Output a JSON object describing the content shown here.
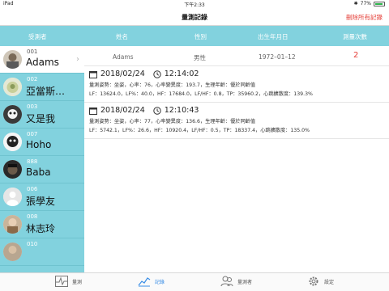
{
  "status_bar": {
    "device": "iPad",
    "time": "下午2:33",
    "battery": "77%",
    "battery_level": 0.77
  },
  "nav": {
    "title": "量測記錄",
    "delete_all": "刪除所有記錄"
  },
  "table_header": {
    "subject": "受測者",
    "name": "姓名",
    "gender": "性別",
    "birthdate": "出生年月日",
    "count": "測量次數"
  },
  "selected_subject": {
    "name": "Adams",
    "gender": "男性",
    "birthdate": "1972–01–12",
    "count": "2"
  },
  "subjects": [
    {
      "id": "001",
      "name": "Adams"
    },
    {
      "id": "002",
      "name": "亞當斯…"
    },
    {
      "id": "003",
      "name": "又是我"
    },
    {
      "id": "007",
      "name": "Hoho"
    },
    {
      "id": "888",
      "name": "Baba"
    },
    {
      "id": "006",
      "name": "張學友"
    },
    {
      "id": "008",
      "name": "林志玲"
    },
    {
      "id": "010",
      "name": ""
    }
  ],
  "records": [
    {
      "date": "2018/02/24",
      "time": "12:14:02",
      "line1": "量測姿勢：坐姿，心率：76，心率變異度：193.7，生理年齡：優於同齡值",
      "line2": "LF：13624.0，LF%：40.0，HF：17684.0，LF/HF：0.8，TP：35960.2，心跳擴散度：139.3%"
    },
    {
      "date": "2018/02/24",
      "time": "12:10:43",
      "line1": "量測姿勢：坐姿，心率：77，心率變異度：136.6，生理年齡：優於同齡值",
      "line2": "LF：5742.1，LF%：26.6，HF：10920.4，LF/HF：0.5，TP：18337.4，心跳擴散度：135.0%"
    }
  ],
  "tabs": [
    {
      "label": "量測",
      "icon": "heartbeat-icon"
    },
    {
      "label": "記錄",
      "icon": "chart-trend-icon"
    },
    {
      "label": "量測者",
      "icon": "people-icon"
    },
    {
      "label": "設定",
      "icon": "gear-icon"
    }
  ],
  "colors": {
    "header_bg": "#82d2de",
    "delete_red": "#e5403a",
    "count_red": "#e5403a",
    "tab_active": "#3a8ee6"
  }
}
